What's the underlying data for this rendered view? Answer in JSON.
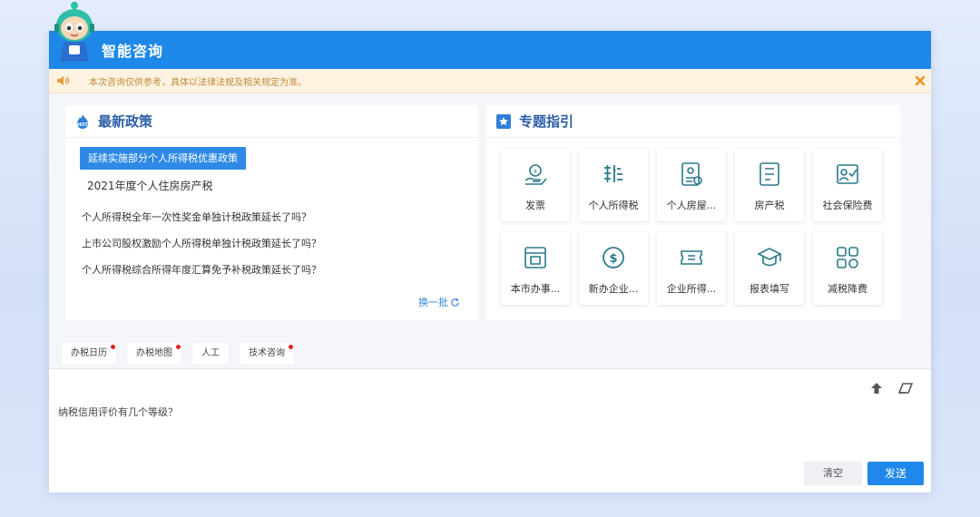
{
  "header": {
    "title": "智能咨询"
  },
  "notice": {
    "text": "本次咨询仅供参考，具体以法律法规及相关规定为准。"
  },
  "policy": {
    "title": "最新政策",
    "active_tab": "延续实施部分个人所得税优惠政策",
    "second_tab": "2021年度个人住房房产税",
    "questions": [
      "个人所得税全年一次性奖金单独计税政策延长了吗？",
      "上市公司股权激励个人所得税单独计税政策延长了吗？",
      "个人所得税综合所得年度汇算免予补税政策延长了吗？"
    ],
    "refresh_label": "换一批"
  },
  "topics": {
    "title": "专题指引",
    "items": [
      {
        "label": "发票",
        "icon": "invoice-icon"
      },
      {
        "label": "个人所得税",
        "icon": "personal-tax-icon"
      },
      {
        "label": "个人房屋...",
        "icon": "house-document-icon"
      },
      {
        "label": "房产税",
        "icon": "property-tax-icon"
      },
      {
        "label": "社会保险费",
        "icon": "social-insurance-icon"
      },
      {
        "label": "本市办事...",
        "icon": "city-affairs-icon"
      },
      {
        "label": "新办企业...",
        "icon": "dollar-coin-icon"
      },
      {
        "label": "企业所得...",
        "icon": "ticket-icon"
      },
      {
        "label": "报表填写",
        "icon": "graduation-cap-icon"
      },
      {
        "label": "减税降费",
        "icon": "grid-apps-icon"
      }
    ]
  },
  "quick_links": [
    {
      "label": "办税日历",
      "dot": true
    },
    {
      "label": "办税地图",
      "dot": true
    },
    {
      "label": "人工",
      "dot": false
    },
    {
      "label": "技术咨询",
      "dot": true
    }
  ],
  "input": {
    "value": "纳税信用评价有几个等级？"
  },
  "buttons": {
    "clear": "清空",
    "send": "发送"
  },
  "colors": {
    "primary": "#1e88e8",
    "notice_bg": "#fdf3e0",
    "notice_text": "#c0893c",
    "badge": "#e02020"
  }
}
